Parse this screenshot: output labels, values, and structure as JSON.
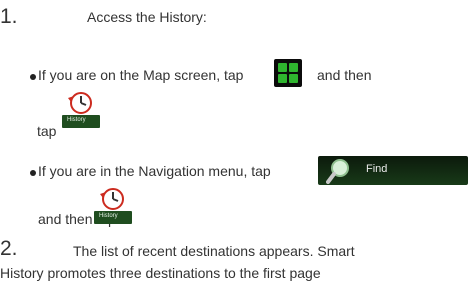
{
  "step1": {
    "number": "1.",
    "title": "Access the History:",
    "bullet1_a": "If you are on the Map screen, tap",
    "bullet1_b": "and then",
    "bullet1_c": "tap",
    "bullet2_a": "If you are in the Navigation menu, tap",
    "bullet2_b": "and then tap"
  },
  "icons": {
    "history_label": "History",
    "find_label": "Find"
  },
  "step2": {
    "number": "2.",
    "line1": "The list of recent destinations appears. Smart",
    "line2": "History promotes three destinations to the first page"
  }
}
